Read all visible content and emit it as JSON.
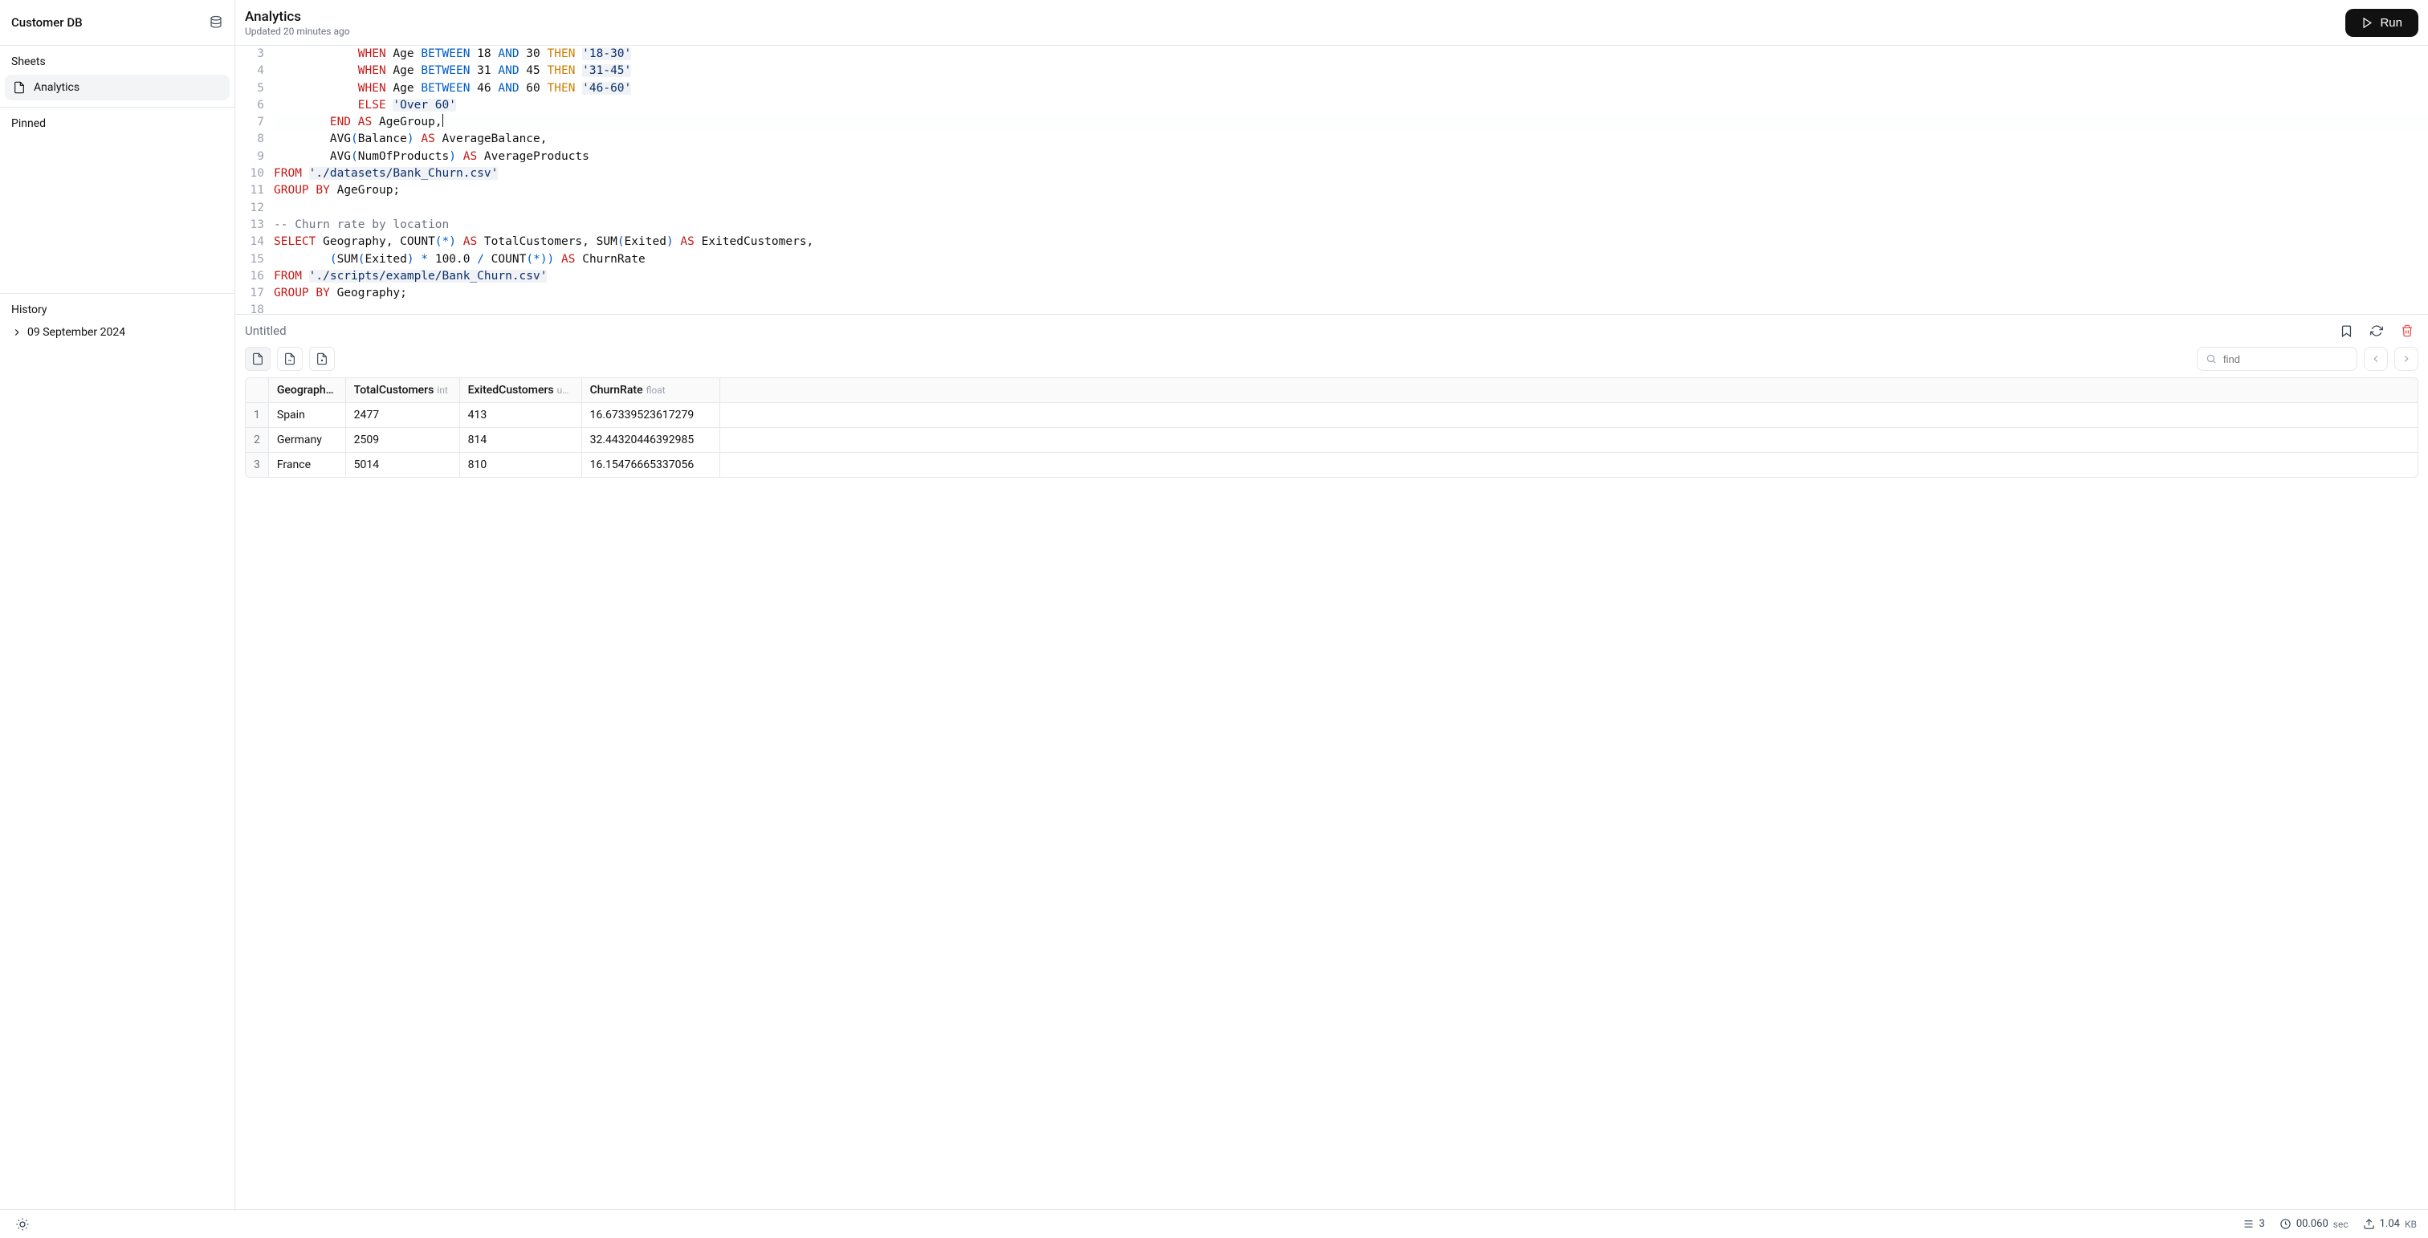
{
  "workspace": {
    "name": "Customer DB"
  },
  "sidebar": {
    "sheets_label": "Sheets",
    "items": [
      {
        "label": "Analytics",
        "active": true
      }
    ],
    "pinned_label": "Pinned",
    "history_label": "History",
    "history": [
      {
        "label": "09 September 2024"
      }
    ]
  },
  "header": {
    "title": "Analytics",
    "subtitle": "Updated 20 minutes ago",
    "run_label": "Run"
  },
  "editor": {
    "first_line_number": 3,
    "lines": [
      {
        "n": 3,
        "segs": [
          [
            "",
            "            "
          ],
          [
            "kw-red",
            "WHEN"
          ],
          [
            "",
            " Age "
          ],
          [
            "kw-blue",
            "BETWEEN"
          ],
          [
            "",
            " 18 "
          ],
          [
            "kw-blue",
            "AND"
          ],
          [
            "",
            " 30 "
          ],
          [
            "kw-orange",
            "THEN"
          ],
          [
            "",
            " "
          ],
          [
            "kw-str",
            "'18-30'"
          ]
        ]
      },
      {
        "n": 4,
        "segs": [
          [
            "",
            "            "
          ],
          [
            "kw-red",
            "WHEN"
          ],
          [
            "",
            " Age "
          ],
          [
            "kw-blue",
            "BETWEEN"
          ],
          [
            "",
            " 31 "
          ],
          [
            "kw-blue",
            "AND"
          ],
          [
            "",
            " 45 "
          ],
          [
            "kw-orange",
            "THEN"
          ],
          [
            "",
            " "
          ],
          [
            "kw-str",
            "'31-45'"
          ]
        ]
      },
      {
        "n": 5,
        "segs": [
          [
            "",
            "            "
          ],
          [
            "kw-red",
            "WHEN"
          ],
          [
            "",
            " Age "
          ],
          [
            "kw-blue",
            "BETWEEN"
          ],
          [
            "",
            " 46 "
          ],
          [
            "kw-blue",
            "AND"
          ],
          [
            "",
            " 60 "
          ],
          [
            "kw-orange",
            "THEN"
          ],
          [
            "",
            " "
          ],
          [
            "kw-str",
            "'46-60'"
          ]
        ]
      },
      {
        "n": 6,
        "segs": [
          [
            "",
            "            "
          ],
          [
            "kw-red",
            "ELSE"
          ],
          [
            "",
            " "
          ],
          [
            "kw-str",
            "'Over 60'"
          ]
        ]
      },
      {
        "n": 7,
        "active": true,
        "segs": [
          [
            "",
            "        "
          ],
          [
            "kw-red",
            "END"
          ],
          [
            "",
            " "
          ],
          [
            "kw-red",
            "AS"
          ],
          [
            "",
            " AgeGroup,"
          ]
        ],
        "cursor": true
      },
      {
        "n": 8,
        "segs": [
          [
            "",
            "        AVG"
          ],
          [
            "paren",
            "("
          ],
          [
            "",
            "Balance"
          ],
          [
            "paren",
            ")"
          ],
          [
            "",
            " "
          ],
          [
            "kw-red",
            "AS"
          ],
          [
            "",
            " AverageBalance,"
          ]
        ]
      },
      {
        "n": 9,
        "segs": [
          [
            "",
            "        AVG"
          ],
          [
            "paren",
            "("
          ],
          [
            "",
            "NumOfProducts"
          ],
          [
            "paren",
            ")"
          ],
          [
            "",
            " "
          ],
          [
            "kw-red",
            "AS"
          ],
          [
            "",
            " AverageProducts"
          ]
        ]
      },
      {
        "n": 10,
        "segs": [
          [
            "kw-red",
            "FROM"
          ],
          [
            "",
            " "
          ],
          [
            "kw-str",
            "'./datasets/Bank_Churn.csv'"
          ]
        ]
      },
      {
        "n": 11,
        "segs": [
          [
            "kw-red",
            "GROUP"
          ],
          [
            "",
            " "
          ],
          [
            "kw-red",
            "BY"
          ],
          [
            "",
            " AgeGroup;"
          ]
        ]
      },
      {
        "n": 12,
        "segs": [
          [
            "",
            ""
          ]
        ]
      },
      {
        "n": 13,
        "segs": [
          [
            "kw-gray",
            "-- Churn rate by location"
          ]
        ]
      },
      {
        "n": 14,
        "segs": [
          [
            "kw-red",
            "SELECT"
          ],
          [
            "",
            " Geography, COUNT"
          ],
          [
            "paren",
            "("
          ],
          [
            "kw-blue",
            "*"
          ],
          [
            "paren",
            ")"
          ],
          [
            "",
            " "
          ],
          [
            "kw-red",
            "AS"
          ],
          [
            "",
            " TotalCustomers, SUM"
          ],
          [
            "paren",
            "("
          ],
          [
            "",
            "Exited"
          ],
          [
            "paren",
            ")"
          ],
          [
            "",
            " "
          ],
          [
            "kw-red",
            "AS"
          ],
          [
            "",
            " ExitedCustomers,"
          ]
        ]
      },
      {
        "n": 15,
        "segs": [
          [
            "",
            "        "
          ],
          [
            "paren",
            "("
          ],
          [
            "",
            "SUM"
          ],
          [
            "paren",
            "("
          ],
          [
            "",
            "Exited"
          ],
          [
            "paren",
            ")"
          ],
          [
            "",
            " "
          ],
          [
            "kw-blue",
            "*"
          ],
          [
            "",
            " 100.0 "
          ],
          [
            "kw-blue",
            "/"
          ],
          [
            "",
            " COUNT"
          ],
          [
            "paren",
            "("
          ],
          [
            "kw-blue",
            "*"
          ],
          [
            "paren",
            "))"
          ],
          [
            "",
            " "
          ],
          [
            "kw-red",
            "AS"
          ],
          [
            "",
            " ChurnRate"
          ]
        ]
      },
      {
        "n": 16,
        "segs": [
          [
            "kw-red",
            "FROM"
          ],
          [
            "",
            " "
          ],
          [
            "kw-str",
            "'./scripts/example/Bank_Churn.csv'"
          ]
        ]
      },
      {
        "n": 17,
        "segs": [
          [
            "kw-red",
            "GROUP"
          ],
          [
            "",
            " "
          ],
          [
            "kw-red",
            "BY"
          ],
          [
            "",
            " Geography;"
          ]
        ]
      },
      {
        "n": 18,
        "segs": [
          [
            "",
            ""
          ]
        ]
      }
    ]
  },
  "results": {
    "title": "Untitled",
    "search_placeholder": "find",
    "columns": [
      {
        "name": "Geograph…",
        "type": ""
      },
      {
        "name": "TotalCustomers",
        "type": "int"
      },
      {
        "name": "ExitedCustomers",
        "type": "u…"
      },
      {
        "name": "ChurnRate",
        "type": "float"
      }
    ],
    "rows": [
      {
        "n": 1,
        "cells": [
          "Spain",
          "2477",
          "413",
          "16.67339523617279"
        ]
      },
      {
        "n": 2,
        "cells": [
          "Germany",
          "2509",
          "814",
          "32.44320446392985"
        ]
      },
      {
        "n": 3,
        "cells": [
          "France",
          "5014",
          "810",
          "16.15476665337056"
        ]
      }
    ]
  },
  "status": {
    "row_count": "3",
    "time_value": "00.060",
    "time_unit": "sec",
    "size_value": "1.04",
    "size_unit": "KB"
  }
}
